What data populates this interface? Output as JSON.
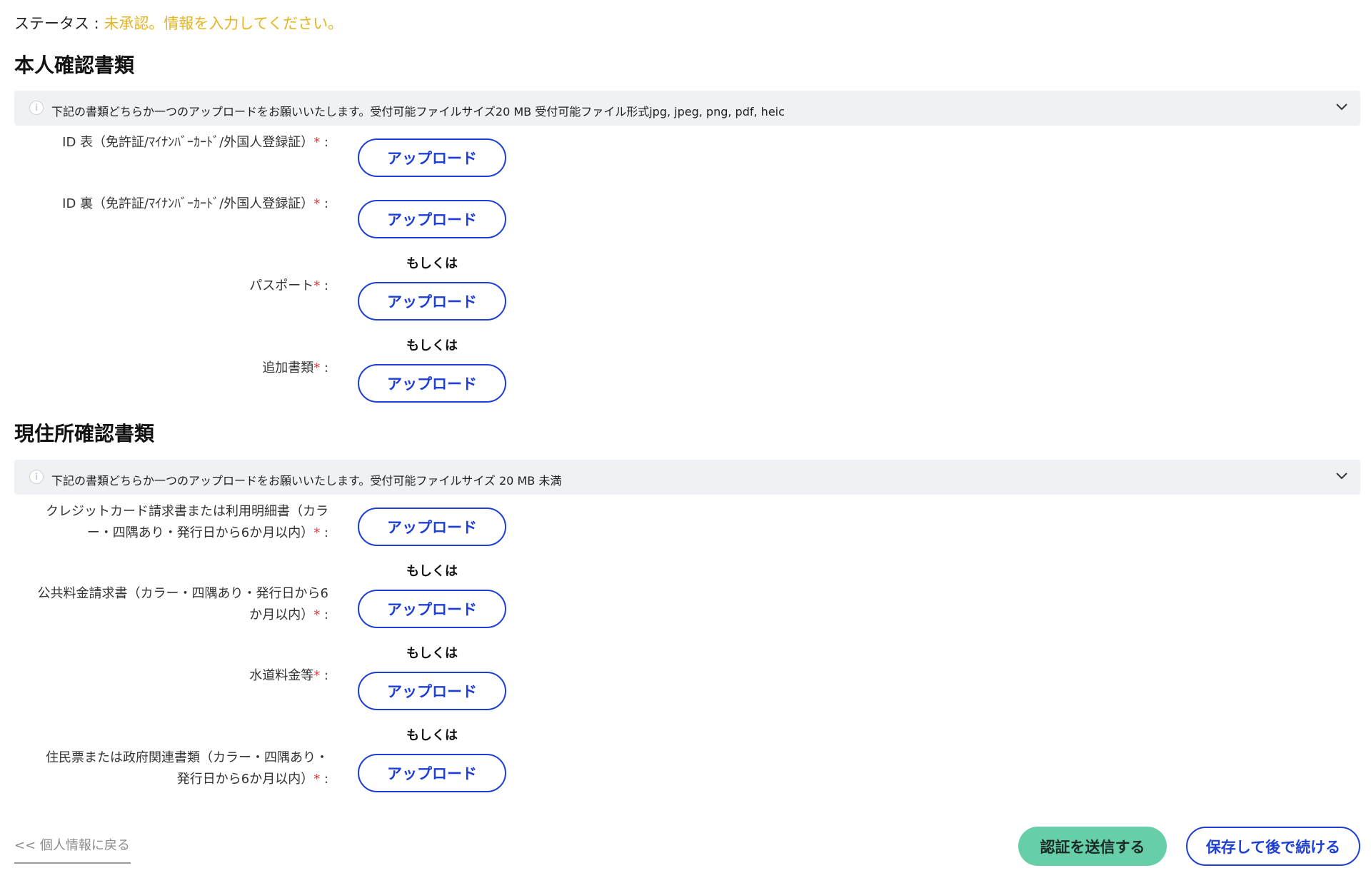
{
  "status": {
    "label": "ステータス : ",
    "value": "未承認。情報を入力してください。",
    "value_color": "#e6b422"
  },
  "identity_section": {
    "title": "本人確認書類",
    "notice": "下記の書類どちらか一つのアップロードをお願いいたします。受付可能ファイルサイズ20 MB 受付可能ファイル形式jpg, jpeg, png, pdf, heic",
    "rows": [
      {
        "label": "ID 表（免許証/ﾏｲﾅﾝﾊﾞｰｶｰﾄﾞ/外国人登録証）",
        "button": "アップロード"
      },
      {
        "label": "ID 裏（免許証/ﾏｲﾅﾝﾊﾞｰｶｰﾄﾞ/外国人登録証）",
        "button": "アップロード"
      },
      {
        "label": "パスポート",
        "button": "アップロード"
      },
      {
        "label": "追加書類",
        "button": "アップロード"
      }
    ]
  },
  "address_section": {
    "title": "現住所確認書類",
    "notice": "下記の書類どちらか一つのアップロードをお願いいたします。受付可能ファイルサイズ 20 MB 未満",
    "rows": [
      {
        "label_line1": "クレジットカード請求書または利用明細書（カラ",
        "label_line2": "ー・四隅あり・発行日から6か月以内）",
        "button": "アップロード"
      },
      {
        "label_line1": "公共料金請求書（カラー・四隅あり・発行日から6",
        "label_line2": "か月以内）",
        "button": "アップロード"
      },
      {
        "label": "水道料金等",
        "button": "アップロード"
      },
      {
        "label_line1": "住民票または政府関連書類（カラー・四隅あり・",
        "label_line2": "発行日から6か月以内）",
        "button": "アップロード"
      }
    ]
  },
  "required_marker": "*",
  "label_suffix": " :",
  "or_text": "もしくは",
  "footer": {
    "back_link": "<< 個人情報に戻る",
    "submit_button": "認証を送信する",
    "save_button": "保存して後で続ける"
  },
  "colors": {
    "accent_blue": "#1e3fd6",
    "submit_green": "#67cfa7",
    "required_red": "#e33333"
  }
}
